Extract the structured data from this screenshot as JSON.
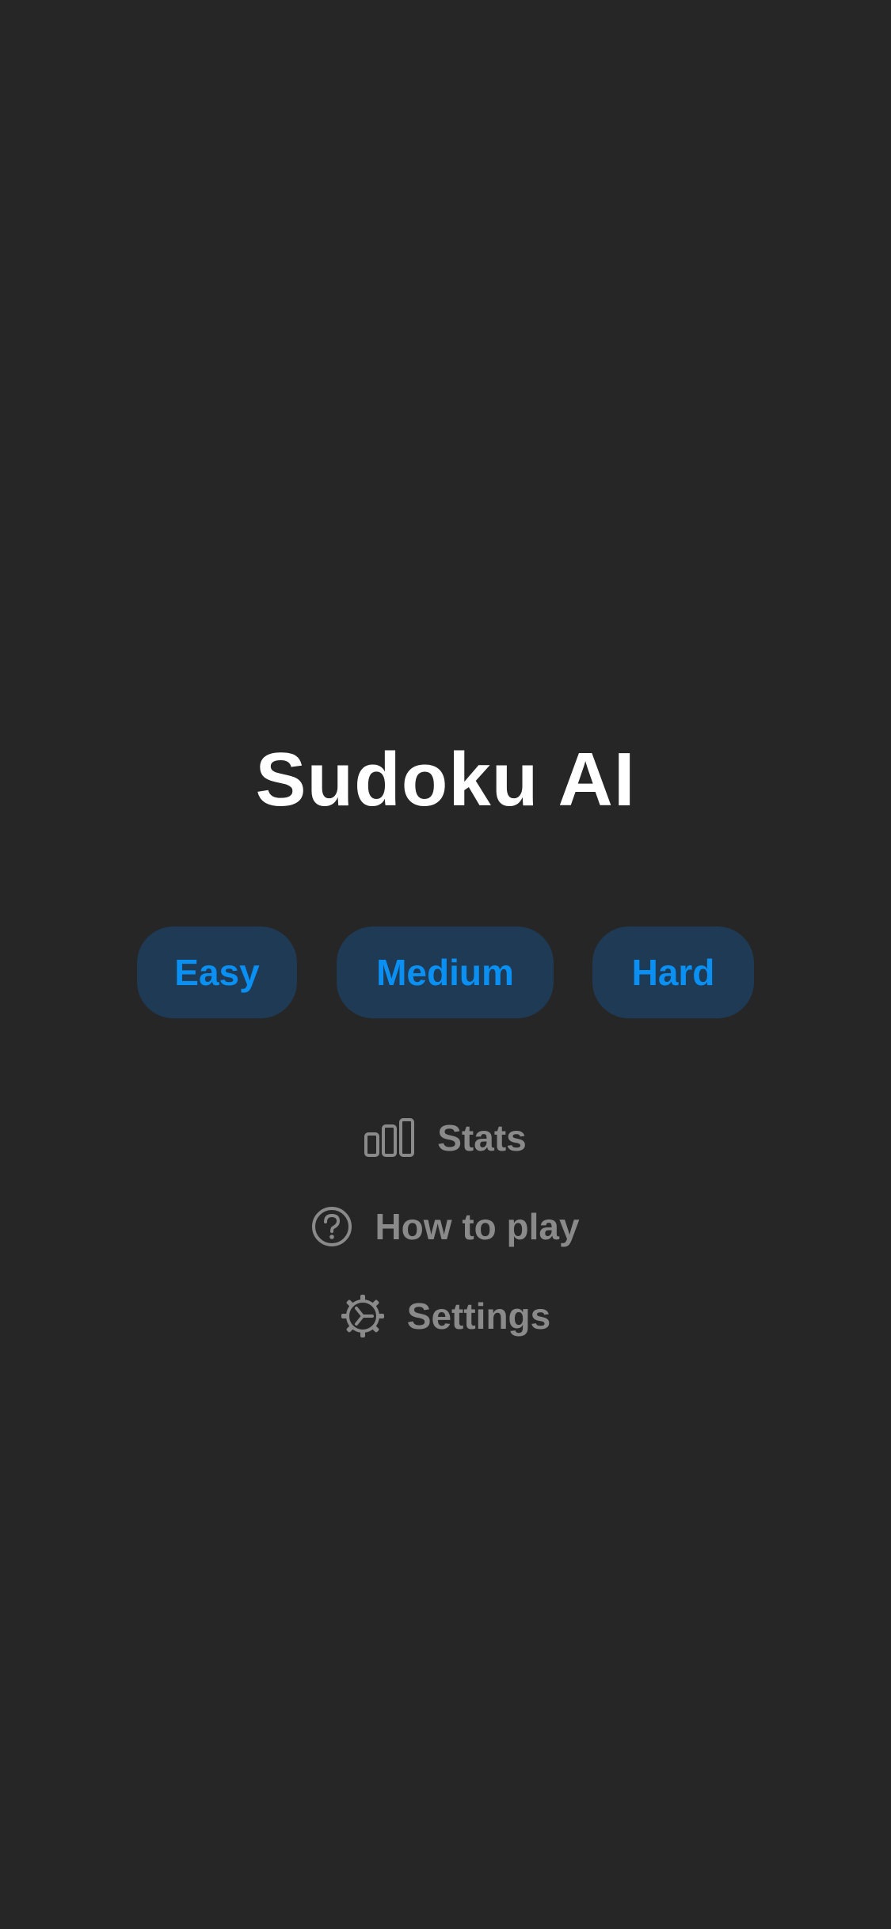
{
  "app": {
    "title": "Sudoku AI"
  },
  "difficulty": {
    "easy_label": "Easy",
    "medium_label": "Medium",
    "hard_label": "Hard"
  },
  "menu": {
    "stats": {
      "label": "Stats",
      "icon": "bar-chart-icon"
    },
    "how_to_play": {
      "label": "How to play",
      "icon": "question-circle-icon"
    },
    "settings": {
      "label": "Settings",
      "icon": "gear-icon"
    }
  },
  "colors": {
    "background": "#262626",
    "button_bg": "#1f3a55",
    "accent": "#0a8ff2",
    "menu_text": "#8a8a8a",
    "title_text": "#ffffff"
  }
}
